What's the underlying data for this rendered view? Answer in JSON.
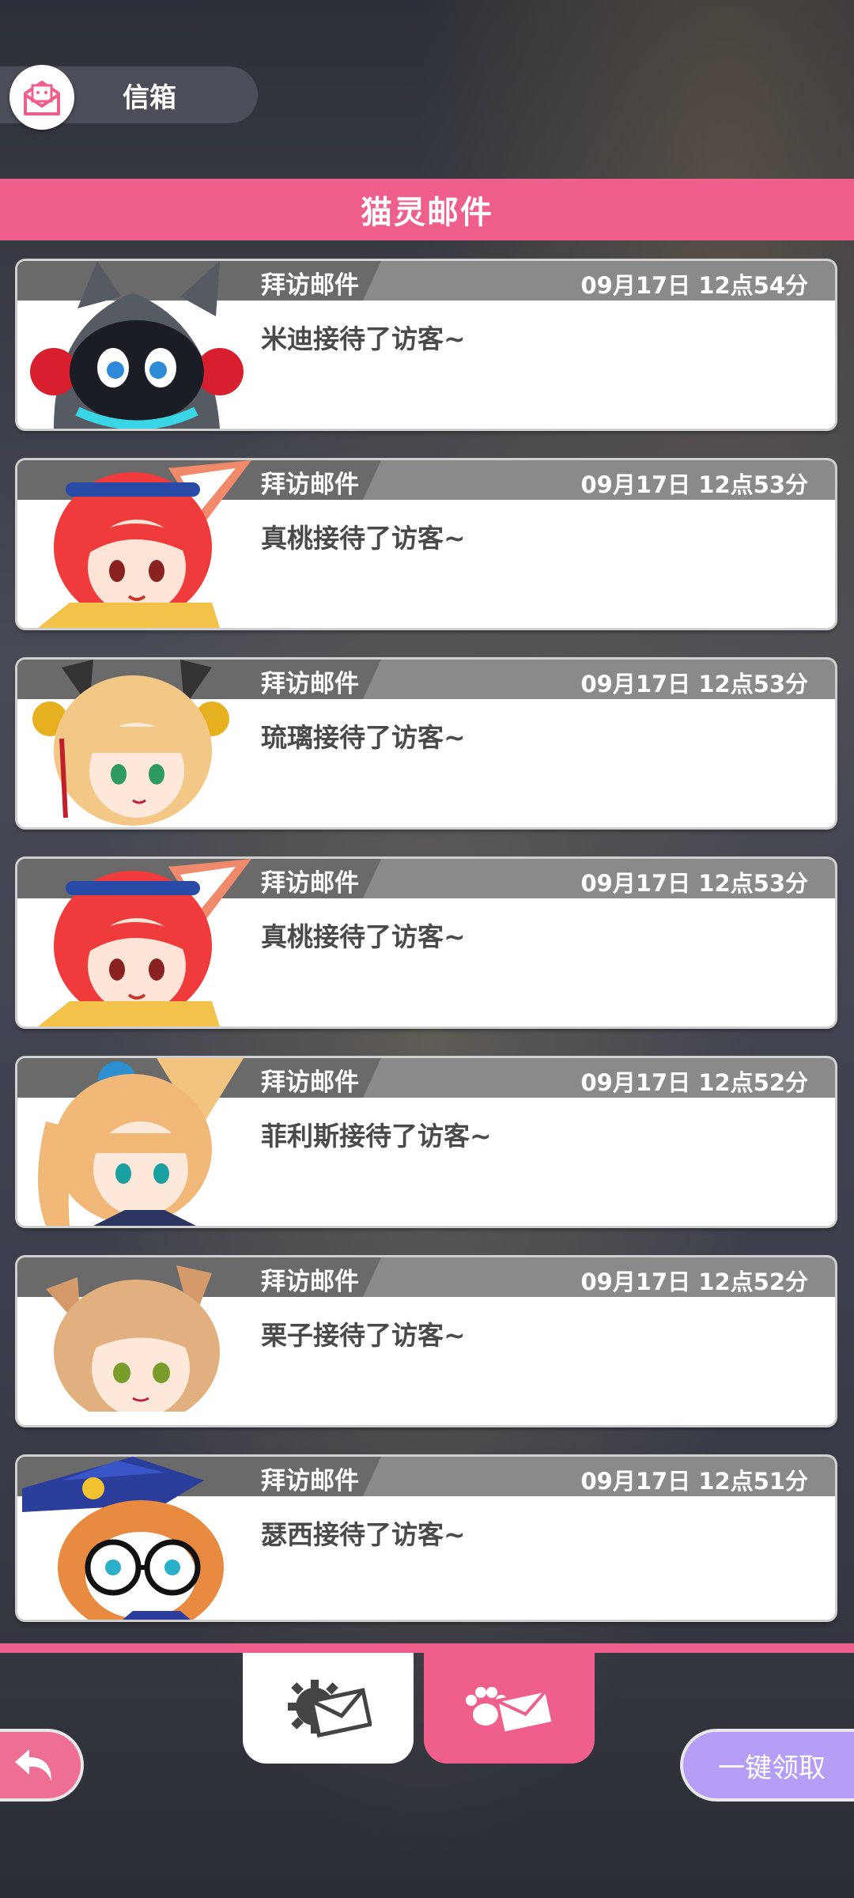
{
  "header": {
    "title": "信箱",
    "icon": "mail-open-icon"
  },
  "page_title": "猫灵邮件",
  "mails": [
    {
      "type": "拜访邮件",
      "time": "09月17日 12点54分",
      "message": "米迪接待了访客~",
      "avatar": "midi-avatar"
    },
    {
      "type": "拜访邮件",
      "time": "09月17日 12点53分",
      "message": "真桃接待了访客~",
      "avatar": "zhentao-avatar"
    },
    {
      "type": "拜访邮件",
      "time": "09月17日 12点53分",
      "message": "琉璃接待了访客~",
      "avatar": "liuli-avatar"
    },
    {
      "type": "拜访邮件",
      "time": "09月17日 12点53分",
      "message": "真桃接待了访客~",
      "avatar": "zhentao-avatar"
    },
    {
      "type": "拜访邮件",
      "time": "09月17日 12点52分",
      "message": "菲利斯接待了访客~",
      "avatar": "feilisi-avatar"
    },
    {
      "type": "拜访邮件",
      "time": "09月17日 12点52分",
      "message": "栗子接待了访客~",
      "avatar": "lizi-avatar"
    },
    {
      "type": "拜访邮件",
      "time": "09月17日 12点51分",
      "message": "瑟西接待了访客~",
      "avatar": "sexi-avatar"
    }
  ],
  "tabs": [
    {
      "name": "system-mail",
      "icon": "gear-mail-icon",
      "active": false
    },
    {
      "name": "cat-mail",
      "icon": "paw-mail-icon",
      "active": true
    }
  ],
  "buttons": {
    "claim_all": "一键领取",
    "back_icon": "back-arrow-icon"
  },
  "colors": {
    "accent": "#ef5f8c",
    "claim": "#b59ef7",
    "header_gray": "#8a8a8a"
  }
}
